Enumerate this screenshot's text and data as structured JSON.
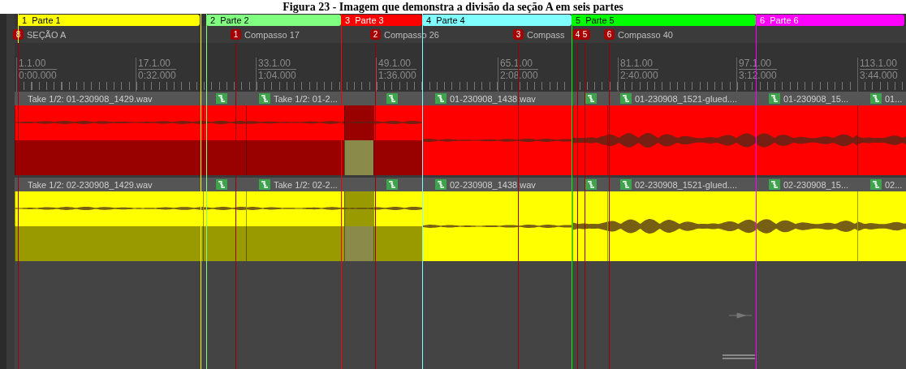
{
  "caption": "Figura 23 - Imagem que demonstra a divisão da seção A em seis partes",
  "regions": [
    {
      "number": "1",
      "label": "Parte 1",
      "color": "#ffff00"
    },
    {
      "number": "2",
      "label": "Parte 2",
      "color": "#80ff80"
    },
    {
      "number": "3",
      "label": "Parte 3",
      "color": "#ff0000"
    },
    {
      "number": "4",
      "label": "Parte 4",
      "color": "#80ffff"
    },
    {
      "number": "5",
      "label": "Parte 5",
      "color": "#00ff00"
    },
    {
      "number": "6",
      "label": "Parte 6",
      "color": "#ff00ff"
    }
  ],
  "markers": [
    {
      "number": "8",
      "label": "SEÇÃO A"
    },
    {
      "number": "1",
      "label": "Compasso 17"
    },
    {
      "number": "2",
      "label": "Compasso 26"
    },
    {
      "number": "3",
      "label": "Compass"
    },
    {
      "number": "4"
    },
    {
      "number": "5"
    },
    {
      "number": "6",
      "label": "Compasso 40"
    }
  ],
  "ruler": [
    {
      "bar": "1.1.00",
      "time": "0:00.000"
    },
    {
      "bar": "17.1.00",
      "time": "0:32.000"
    },
    {
      "bar": "33.1.00",
      "time": "1:04.000"
    },
    {
      "bar": "49.1.00",
      "time": "1:36.000"
    },
    {
      "bar": "65.1.00",
      "time": "2:08.000"
    },
    {
      "bar": "81.1.00",
      "time": "2:40.000"
    },
    {
      "bar": "97.1.00",
      "time": "3:12.000"
    },
    {
      "bar": "113.1.00",
      "time": "3:44.000"
    }
  ],
  "tracks": [
    {
      "color": "#ff0000",
      "items": [
        {
          "label": "Take 1/2: 01-230908_1429.wav",
          "linked": false,
          "kind": "multi-take"
        },
        {
          "linked": true,
          "kind": "multi-take"
        },
        {
          "label": "Take 1/2: 01-2...",
          "linked": true,
          "kind": "multi-take"
        },
        {
          "linked": false,
          "kind": "dim"
        },
        {
          "linked": true,
          "kind": "multi-take"
        },
        {
          "label": "01-230908_1438.wav",
          "linked": true,
          "kind": "single"
        },
        {
          "linked": true,
          "kind": "single"
        },
        {
          "label": "01-230908_1521-glued....",
          "linked": true,
          "kind": "single"
        },
        {
          "label": "01-230908_15...",
          "linked": true,
          "kind": "single"
        },
        {
          "label": "01...",
          "linked": true,
          "kind": "single"
        }
      ]
    },
    {
      "color": "#ffff00",
      "items": [
        {
          "label": "Take 1/2: 02-230908_1429.wav",
          "linked": false,
          "kind": "multi-take"
        },
        {
          "linked": true,
          "kind": "multi-take"
        },
        {
          "label": "Take 1/2: 02-2...",
          "linked": true,
          "kind": "multi-take"
        },
        {
          "linked": false,
          "kind": "dim"
        },
        {
          "linked": true,
          "kind": "multi-take"
        },
        {
          "label": "02-230908_1438.wav",
          "linked": true,
          "kind": "single"
        },
        {
          "linked": true,
          "kind": "single"
        },
        {
          "label": "02-230908_1521-glued....",
          "linked": true,
          "kind": "single"
        },
        {
          "label": "02-230908_15...",
          "linked": true,
          "kind": "single"
        },
        {
          "label": "02...",
          "linked": true,
          "kind": "single"
        }
      ]
    }
  ]
}
